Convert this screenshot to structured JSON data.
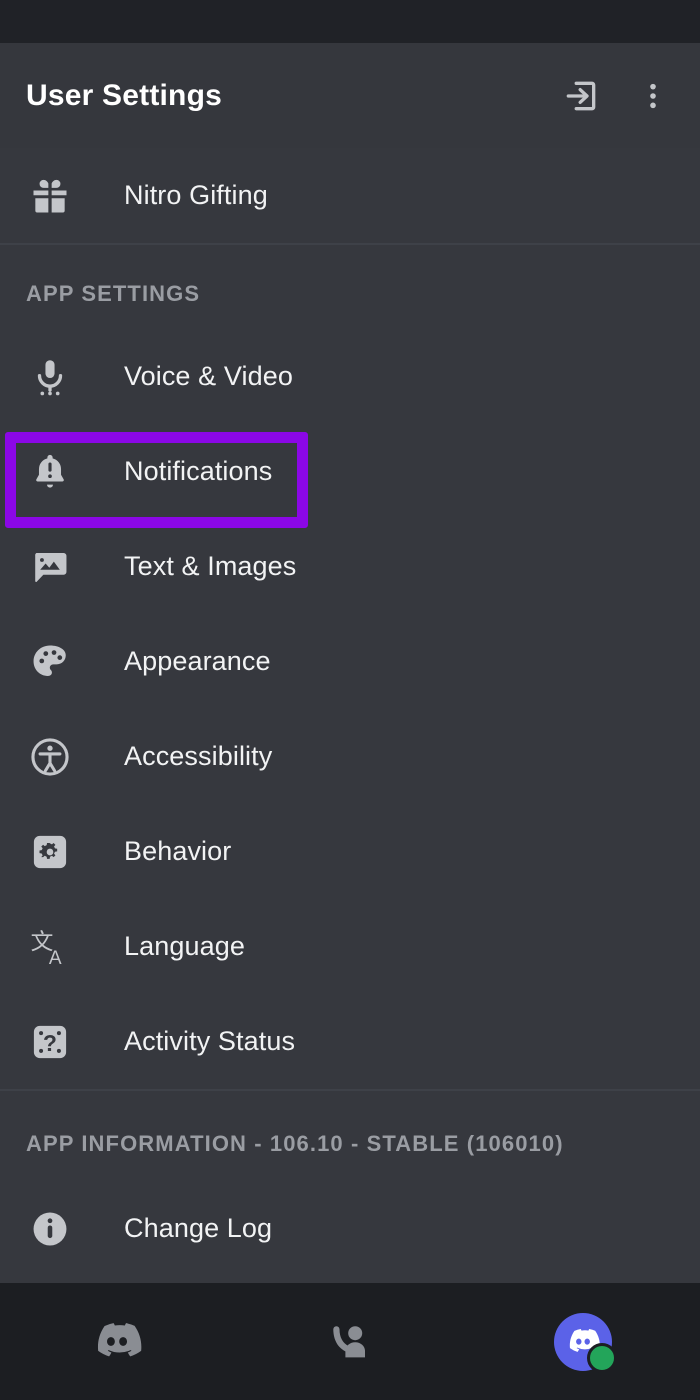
{
  "colors": {
    "background": "#36383e",
    "header_bg": "#35373d",
    "statusbar_bg": "#202227",
    "bottomnav_bg": "#1c1e22",
    "highlight": "#8b07e6",
    "accent_blurple": "#5b62e8",
    "online_green": "#23a55a",
    "icon_gray": "#c4c6ca",
    "section_title_gray": "#9a9da3",
    "text_primary": "#f2f3f4"
  },
  "header": {
    "title": "User Settings",
    "logout_icon": "logout-icon",
    "overflow_icon": "more-vertical-icon"
  },
  "nitro_section": {
    "items": [
      {
        "label": "Nitro Gifting",
        "icon": "gift-icon"
      }
    ]
  },
  "app_settings": {
    "title": "APP SETTINGS",
    "items": [
      {
        "label": "Voice & Video",
        "icon": "microphone-icon",
        "highlighted": false
      },
      {
        "label": "Notifications",
        "icon": "bell-alert-icon",
        "highlighted": true
      },
      {
        "label": "Text & Images",
        "icon": "chat-image-icon",
        "highlighted": false
      },
      {
        "label": "Appearance",
        "icon": "palette-icon",
        "highlighted": false
      },
      {
        "label": "Accessibility",
        "icon": "accessibility-icon",
        "highlighted": false
      },
      {
        "label": "Behavior",
        "icon": "gear-square-icon",
        "highlighted": false
      },
      {
        "label": "Language",
        "icon": "translate-icon",
        "highlighted": false
      },
      {
        "label": "Activity Status",
        "icon": "dice-question-icon",
        "highlighted": false
      }
    ]
  },
  "app_information": {
    "title": "APP INFORMATION - 106.10 - STABLE (106010)",
    "version": "106.10",
    "release_channel": "STABLE",
    "build_number": "106010",
    "items": [
      {
        "label": "Change Log",
        "icon": "info-circle-icon"
      }
    ]
  },
  "bottom_nav": {
    "items": [
      {
        "name": "servers-tab",
        "icon": "discord-logo-icon"
      },
      {
        "name": "friends-tab",
        "icon": "person-wave-icon"
      },
      {
        "name": "profile-tab",
        "icon": "user-avatar-icon",
        "status": "online"
      }
    ]
  }
}
